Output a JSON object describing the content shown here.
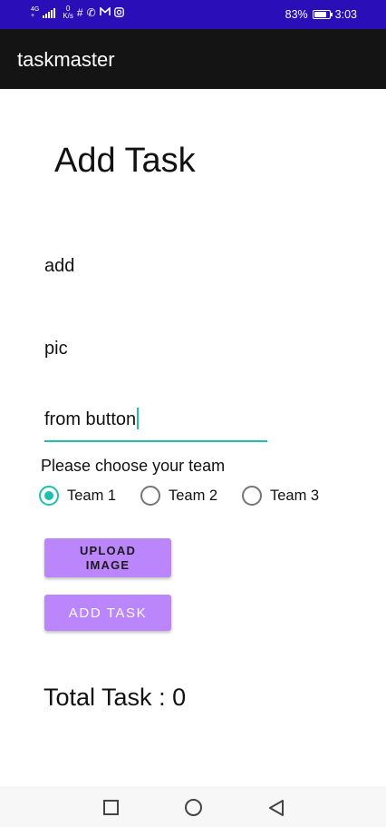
{
  "status_bar": {
    "network_type": "4G",
    "network_sub": "+",
    "speed_value": "0",
    "speed_unit": "K/s",
    "notification_icons": [
      "slack-icon",
      "phone-icon",
      "gmail-icon",
      "instagram-icon"
    ],
    "battery_percent": "83%",
    "battery_level": 0.83,
    "time": "3:03",
    "background_color": "#2a0fb8"
  },
  "app_bar": {
    "title": "taskmaster",
    "background_color": "#141414"
  },
  "form": {
    "title": "Add Task",
    "task_title_value": "add",
    "task_body_value": "pic",
    "task_state_value": "from button",
    "team_prompt": "Please choose your team",
    "teams": [
      {
        "label": "Team 1",
        "checked": true
      },
      {
        "label": "Team 2",
        "checked": false
      },
      {
        "label": "Team 3",
        "checked": false
      }
    ],
    "upload_button_label": "UPLOAD IMAGE",
    "add_button_label": "ADD TASK",
    "total_task_label": "Total Task : 0",
    "accent_color": "#1fbfb0",
    "button_color": "#bb86fc"
  },
  "nav_bar": {
    "buttons": [
      "recents-square-icon",
      "home-circle-icon",
      "back-triangle-icon"
    ]
  }
}
